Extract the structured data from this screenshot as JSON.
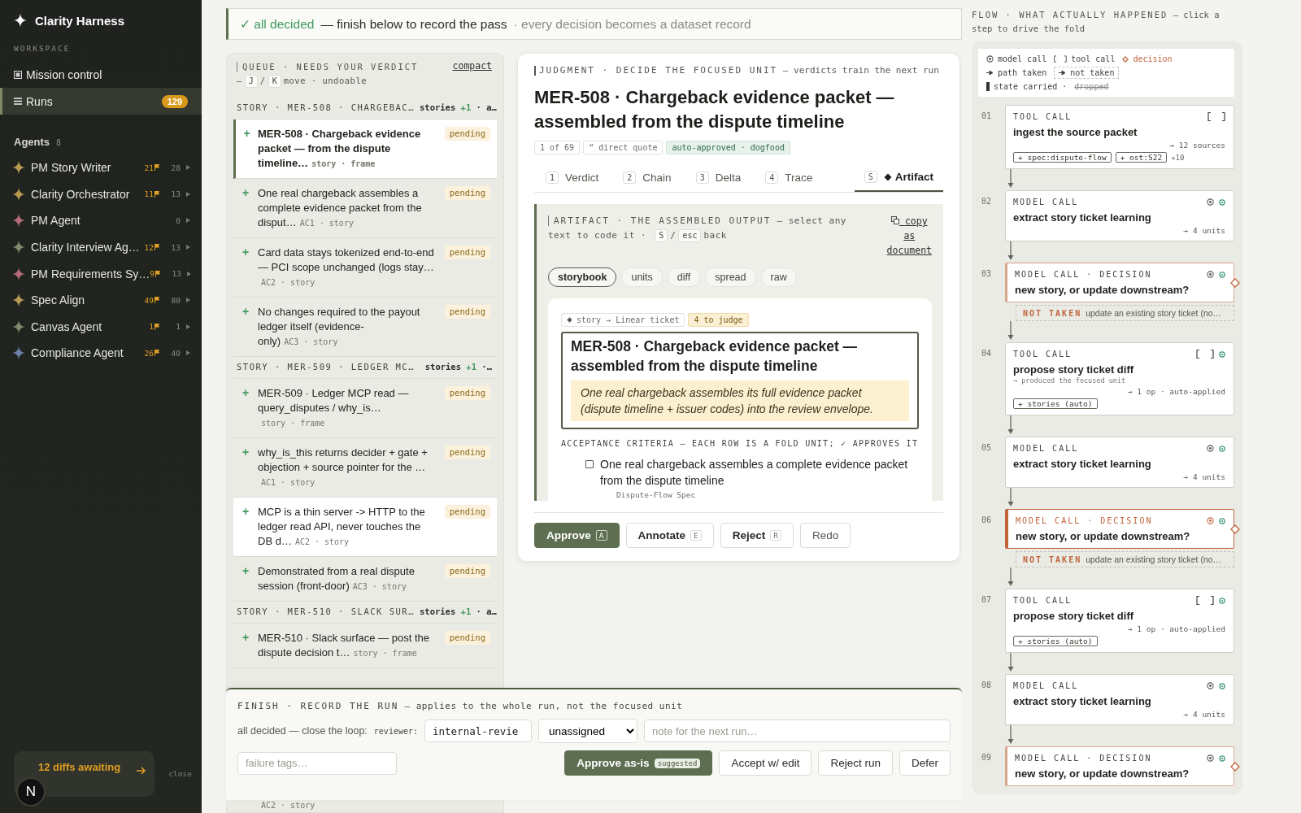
{
  "sidebar": {
    "brand": "Clarity Harness",
    "section_label": "WORKSPACE",
    "nav": [
      {
        "label": "Mission control",
        "selected": false
      },
      {
        "label": "Runs",
        "badge": "129",
        "selected": true
      }
    ],
    "agents_heading": "Agents",
    "agents_count": "8",
    "agents": [
      {
        "name": "PM Story Writer",
        "color": "#b99a52",
        "flags": "21",
        "count": "28"
      },
      {
        "name": "Clarity Orchestrator",
        "color": "#b99a52",
        "flags": "11",
        "count": "13"
      },
      {
        "name": "PM Agent",
        "color": "#b56b7a",
        "count": "0"
      },
      {
        "name": "Clarity Interview Ag…",
        "color": "#7e8a6c",
        "flags": "12",
        "count": "13"
      },
      {
        "name": "PM Requirements Sy…",
        "color": "#b56b7a",
        "flags": "9",
        "count": "13"
      },
      {
        "name": "Spec Align",
        "color": "#b99a52",
        "flags": "49",
        "count": "80"
      },
      {
        "name": "Canvas Agent",
        "color": "#7e8a6c",
        "flags": "1",
        "count": "1"
      },
      {
        "name": "Compliance Agent",
        "color": "#6a80a8",
        "flags": "26",
        "count": "40"
      }
    ],
    "toast": {
      "text": "12 diffs awaiting",
      "action": "close",
      "avatar": "N"
    }
  },
  "banner": {
    "status": "✓ all decided",
    "message": "— finish below to record the pass",
    "note": "· every decision becomes a dataset record"
  },
  "queue": {
    "title": "QUEUE · NEEDS YOUR VERDICT",
    "hint_prefix": "—",
    "keys": [
      "J",
      "K"
    ],
    "key_separator": "/",
    "hint_suffix": "move · undoable",
    "link": "compact",
    "groups": [
      {
        "title": "STORY · MER-508 · CHARGEBAC…",
        "summary": "stories",
        "delta": "+1",
        "summary_end": "· a…",
        "items": [
          {
            "kind": "unit",
            "marker": "+",
            "text": "MER-508 · Chargeback evidence packet — from the dispute timeline…",
            "meta": "story · frame",
            "status": "pending",
            "selected": true,
            "highlighted": false
          },
          {
            "kind": "unit",
            "marker": "+",
            "text": "One real chargeback assembles a complete evidence packet from the disput…",
            "meta": "AC1 · story",
            "status": "pending",
            "selected": false,
            "highlighted": false
          },
          {
            "kind": "unit",
            "marker": "+",
            "text": "Card data stays tokenized end-to-end — PCI scope unchanged (logs stay…",
            "meta": "AC2 · story",
            "status": "pending",
            "selected": false,
            "highlighted": false
          },
          {
            "kind": "unit",
            "marker": "+",
            "text": "No changes required to the payout ledger itself (evidence-only)",
            "meta": "AC3 · story",
            "status": "pending",
            "selected": false,
            "highlighted": false
          }
        ]
      },
      {
        "title": "STORY · MER-509 · LEDGER MC…",
        "summary": "stories",
        "delta": "+1",
        "summary_end": "·…",
        "items": [
          {
            "kind": "unit",
            "marker": "+",
            "text": "MER-509 · Ledger MCP read — query_disputes / why_is…",
            "meta": "story · frame",
            "status": "pending",
            "selected": false,
            "highlighted": false
          },
          {
            "kind": "unit",
            "marker": "+",
            "text": "why_is_this returns decider + gate + objection + source pointer for the …",
            "meta": "AC1 · story",
            "status": "pending",
            "selected": false,
            "highlighted": false
          },
          {
            "kind": "unit",
            "marker": "+",
            "text": "MCP is a thin server -> HTTP to the ledger read API, never touches the DB d…",
            "meta": "AC2 · story",
            "status": "pending",
            "selected": false,
            "highlighted": true
          },
          {
            "kind": "unit",
            "marker": "+",
            "text": "Demonstrated from a real dispute session (front-door)",
            "meta": "AC3 · story",
            "status": "pending",
            "selected": false,
            "highlighted": false
          }
        ]
      },
      {
        "title": "STORY · MER-510 · SLACK SUR…",
        "summary": "stories",
        "delta": "+1",
        "summary_end": "· a…",
        "items": [
          {
            "kind": "unit",
            "marker": "+",
            "text": "MER-510 · Slack surface — post the dispute decision t…",
            "meta": "story · frame",
            "status": "pending",
            "selected": false,
            "highlighted": false
          },
          {
            "kind": "tail",
            "meta": "AC2 · story"
          }
        ]
      }
    ]
  },
  "judgment": {
    "eyebrow": "JUDGMENT · DECIDE THE FOCUSED UNIT",
    "eyebrow_note": "— verdicts train the next run",
    "title": "MER-508 · Chargeback evidence packet — assembled from the dispute timeline",
    "chips": [
      {
        "text": "1 of 69",
        "kind": "counter"
      },
      {
        "text": "“ direct quote",
        "kind": "quote"
      },
      {
        "text": "auto-approved · dogfood",
        "kind": "status"
      }
    ],
    "tabs": [
      {
        "key": "1",
        "label": "Verdict",
        "selected": false
      },
      {
        "key": "2",
        "label": "Chain",
        "selected": false
      },
      {
        "key": "3",
        "label": "Delta",
        "selected": false
      },
      {
        "key": "4",
        "label": "Trace",
        "selected": false
      },
      {
        "key": "S",
        "label": "Artifact",
        "selected": true
      }
    ],
    "artifact": {
      "eyebrow": "ARTIFACT · THE ASSEMBLED OUTPUT",
      "hint": [
        "— select any",
        "text to code it ·"
      ],
      "keys": [
        "S",
        "esc"
      ],
      "key_separator": "/",
      "back": "back",
      "link": "copy as document",
      "views": [
        {
          "label": "storybook",
          "selected": true
        },
        {
          "label": "units",
          "selected": false
        },
        {
          "label": "diff",
          "selected": false
        },
        {
          "label": "spread",
          "selected": false
        },
        {
          "label": "raw",
          "selected": false
        }
      ],
      "chips": [
        {
          "text": "story → Linear ticket",
          "kind": "route"
        },
        {
          "text": "4 to judge",
          "kind": "count"
        }
      ],
      "story": {
        "title": "MER-508 · Chargeback evidence packet — assembled from the dispute timeline",
        "summary": "One real chargeback assembles its full evidence packet (dispute timeline + issuer codes) into the review envelope."
      },
      "criteria_heading": "ACCEPTANCE CRITERIA — EACH ROW IS A FOLD UNIT; ✓ APPROVES IT",
      "criteria": [
        {
          "text": "One real chargeback assembles a complete evidence packet from the dispute timeline",
          "source": "Dispute-Flow Spec",
          "checked": false
        }
      ]
    },
    "actions": [
      {
        "label": "Approve",
        "key": "A",
        "kind": "primary"
      },
      {
        "label": "Annotate",
        "key": "E",
        "kind": "secondary"
      },
      {
        "label": "Reject",
        "key": "R",
        "kind": "secondary"
      },
      {
        "label": "Redo",
        "kind": "tertiary"
      }
    ]
  },
  "finish": {
    "eyebrow": "FINISH · RECORD THE RUN",
    "eyebrow_note": "— applies to the whole run, not the focused unit",
    "lead": "all decided — close the loop:",
    "reviewer_label": "reviewer:",
    "reviewer": "internal-revie",
    "assignee": "unassigned",
    "note_placeholder": "note for the next run…",
    "tags_placeholder": "failure tags…",
    "actions": [
      {
        "label": "Approve as-is",
        "badge": "suggested",
        "kind": "primary"
      },
      {
        "label": "Accept w/ edit",
        "kind": "plain"
      },
      {
        "label": "Reject run",
        "kind": "plain"
      },
      {
        "label": "Defer",
        "kind": "plain"
      }
    ]
  },
  "flow": {
    "eyebrow": "FLOW · WHAT ACTUALLY HAPPENED",
    "eyebrow_note": "— click a step to drive the fold",
    "legend": [
      [
        {
          "kind": "model",
          "text": "model call"
        },
        {
          "kind": "tool",
          "text": "tool call"
        },
        {
          "kind": "decision",
          "text": "decision"
        }
      ],
      [
        {
          "kind": "taken",
          "text": "path taken"
        },
        {
          "kind": "not_taken",
          "text": "not taken"
        }
      ],
      [
        {
          "kind": "state",
          "text": "state carried ·"
        },
        {
          "kind": "dropped",
          "text": "dropped"
        }
      ]
    ],
    "steps": [
      {
        "number": "01",
        "kind": "tool",
        "label": "TOOL CALL",
        "title": "ingest the source packet",
        "output": "→ 12 sources",
        "tags": [
          "+ spec:dispute-flow",
          "+ ost:S22"
        ],
        "more": "+10",
        "complete": false,
        "selected": false
      },
      {
        "number": "02",
        "kind": "model",
        "label": "MODEL CALL",
        "title": "extract story ticket learning",
        "output": "→ 4 units",
        "complete": true,
        "selected": false
      },
      {
        "number": "03",
        "kind": "decision",
        "label": "MODEL CALL · DECISION",
        "title": "new story, or update downstream?",
        "not_taken": {
          "label": "NOT TAKEN",
          "text": "update an existing story ticket (no…"
        },
        "complete": true,
        "selected": false
      },
      {
        "number": "04",
        "kind": "tool",
        "label": "TOOL CALL",
        "title": "propose story ticket diff",
        "note": "→ produced the focused unit",
        "output": "→ 1 op · auto-applied",
        "tags": [
          "+ stories (auto)"
        ],
        "complete": true,
        "selected": false
      },
      {
        "number": "05",
        "kind": "model",
        "label": "MODEL CALL",
        "title": "extract story ticket learning",
        "output": "→ 4 units",
        "complete": true,
        "selected": false
      },
      {
        "number": "06",
        "kind": "decision",
        "label": "MODEL CALL · DECISION",
        "title": "new story, or update downstream?",
        "not_taken": {
          "label": "NOT TAKEN",
          "text": "update an existing story ticket (no…"
        },
        "complete": true,
        "selected": true
      },
      {
        "number": "07",
        "kind": "tool",
        "label": "TOOL CALL",
        "title": "propose story ticket diff",
        "output": "→ 1 op · auto-applied",
        "tags": [
          "+ stories (auto)"
        ],
        "complete": true,
        "selected": false
      },
      {
        "number": "08",
        "kind": "model",
        "label": "MODEL CALL",
        "title": "extract story ticket learning",
        "output": "→ 4 units",
        "complete": true,
        "selected": false
      },
      {
        "number": "09",
        "kind": "decision",
        "label": "MODEL CALL · DECISION",
        "title": "new story, or update downstream?",
        "complete": true,
        "selected": false
      }
    ]
  }
}
